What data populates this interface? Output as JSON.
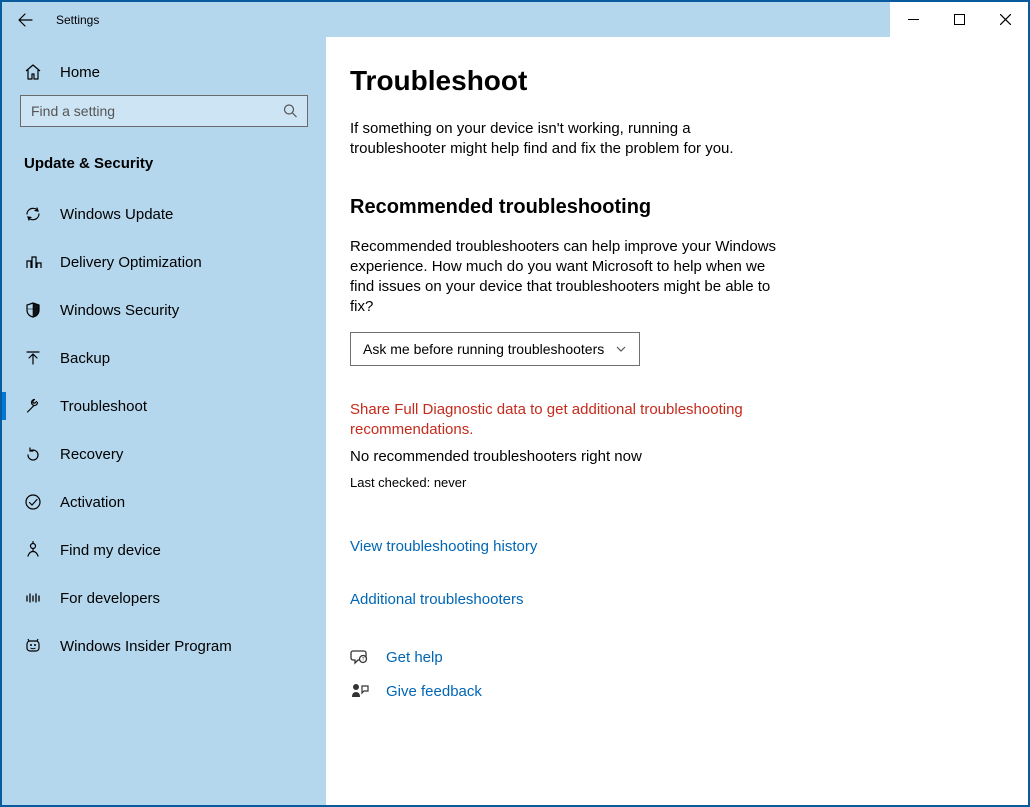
{
  "titlebar": {
    "app_title": "Settings"
  },
  "sidebar": {
    "home_label": "Home",
    "search_placeholder": "Find a setting",
    "category_label": "Update & Security",
    "items": [
      {
        "icon": "sync-icon",
        "label": "Windows Update"
      },
      {
        "icon": "delivery-icon",
        "label": "Delivery Optimization"
      },
      {
        "icon": "shield-icon",
        "label": "Windows Security"
      },
      {
        "icon": "backup-icon",
        "label": "Backup"
      },
      {
        "icon": "wrench-icon",
        "label": "Troubleshoot"
      },
      {
        "icon": "recovery-icon",
        "label": "Recovery"
      },
      {
        "icon": "activation-icon",
        "label": "Activation"
      },
      {
        "icon": "find-device-icon",
        "label": "Find my device"
      },
      {
        "icon": "developer-icon",
        "label": "For developers"
      },
      {
        "icon": "insider-icon",
        "label": "Windows Insider Program"
      }
    ],
    "selected_index": 4
  },
  "main": {
    "title": "Troubleshoot",
    "intro": "If something on your device isn't working, running a troubleshooter might help find and fix the problem for you.",
    "section_title": "Recommended troubleshooting",
    "section_text": "Recommended troubleshooters can help improve your Windows experience. How much do you want Microsoft to help when we find issues on your device that troubleshooters might be able to fix?",
    "dropdown_value": "Ask me before running troubleshooters",
    "warning": "Share Full Diagnostic data to get additional troubleshooting recommendations.",
    "status_text": "No recommended troubleshooters right now",
    "last_checked": "Last checked: never",
    "history_link": "View troubleshooting history",
    "additional_link": "Additional troubleshooters",
    "get_help": "Get help",
    "give_feedback": "Give feedback"
  }
}
